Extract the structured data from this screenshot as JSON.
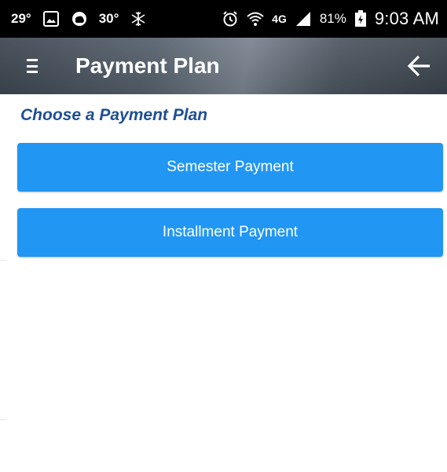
{
  "status_bar": {
    "temp_left": "29°",
    "temp_right": "30°",
    "network": "4G",
    "battery": "81%",
    "time": "9:03 AM",
    "icons": [
      "image-icon",
      "weather-icon",
      "snowflake-icon",
      "alarm-icon",
      "wifi-icon",
      "signal-icon",
      "battery-charging-icon"
    ]
  },
  "app_bar": {
    "title": "Payment Plan",
    "menu_icon": "menu-icon",
    "back_icon": "back-arrow-icon"
  },
  "content": {
    "heading": "Choose a Payment Plan",
    "buttons": [
      {
        "label": "Semester Payment"
      },
      {
        "label": "Installment Payment"
      }
    ]
  },
  "colors": {
    "button": "#2196f3",
    "heading": "#1f4e96",
    "status_bar": "#000000"
  }
}
